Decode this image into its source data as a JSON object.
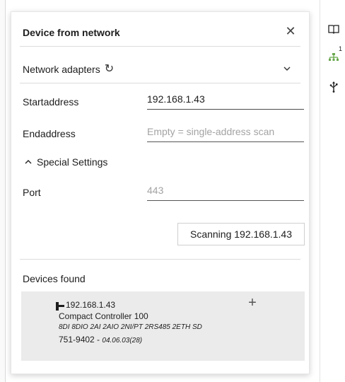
{
  "dialog": {
    "title": "Device from network",
    "close_glyph": "✕"
  },
  "network_adapters": {
    "label": "Network adapters",
    "refresh_glyph": "↻"
  },
  "start_address": {
    "label": "Startaddress",
    "value": "192.168.1.43"
  },
  "end_address": {
    "label": "Endaddress",
    "placeholder": "Empty = single-address scan"
  },
  "special_settings": {
    "label": "Special Settings"
  },
  "port": {
    "label": "Port",
    "placeholder": "443"
  },
  "scan_button": {
    "label": "Scanning 192.168.1.43"
  },
  "devices_found": {
    "label": "Devices found",
    "items": [
      {
        "ip": "192.168.1.43",
        "name": "Compact Controller 100",
        "description": "8DI 8DIO 2AI 2AIO 2NI/PT 2RS485 2ETH SD",
        "order_number": "751-9402",
        "version": "04.06.03(28)",
        "add_glyph": "+"
      }
    ]
  },
  "right_toolbar": {
    "icons": [
      "book-icon",
      "network-icon",
      "usb-icon"
    ],
    "network_badge": "1",
    "network_color": "#6aa84f"
  }
}
